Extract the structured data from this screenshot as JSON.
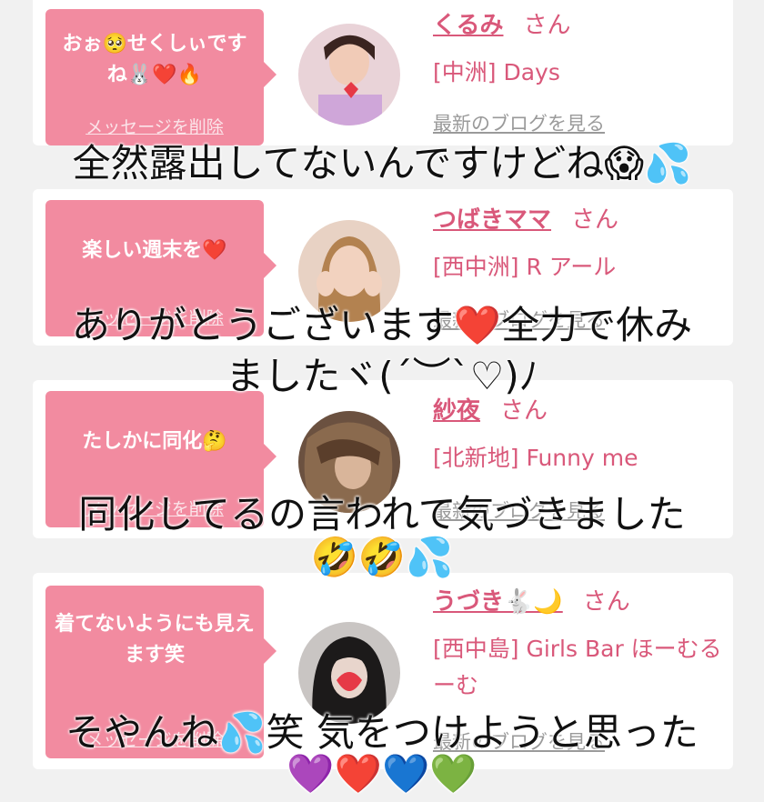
{
  "delete_label": "メッセージを削除",
  "blog_label": "最新のブログを見る",
  "honorific": "さん",
  "cards": [
    {
      "message": "おぉ🥺せくしぃですね🐰❤️🔥",
      "name": "くるみ",
      "shop": "[中洲] Days"
    },
    {
      "message": "楽しい週末を❤️",
      "name": "つばきママ",
      "shop": "[西中洲] R アール"
    },
    {
      "message": "たしかに同化🤔",
      "name": "紗夜",
      "shop": "[北新地] Funny me"
    },
    {
      "message": "着てないようにも見えます笑",
      "name": "うづき🐇🌙",
      "shop": "[西中島] Girls Bar ほーむるーむ"
    }
  ],
  "overlays": {
    "line1": "全然露出してないんですけどね😱💦",
    "line2a": "ありがとうございます❤️全力で休み",
    "line2b": "ましたヾ(´︶`♡)ﾉ",
    "line3a": "同化してるの言われて気づきました",
    "line3b": "🤣🤣💦",
    "line4a": "そやんね💦笑 気をつけようと思った",
    "line4b": "💜❤️💙💚"
  },
  "colors": {
    "accent": "#d9587a",
    "bubble": "#f28ba0"
  }
}
